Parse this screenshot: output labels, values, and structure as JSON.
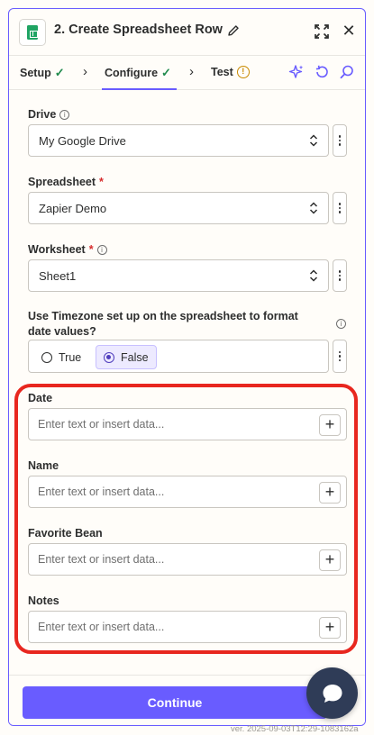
{
  "header": {
    "title": "2. Create Spreadsheet Row",
    "app_icon": "google-sheets-icon"
  },
  "tabs": [
    {
      "label": "Setup",
      "status": "complete"
    },
    {
      "label": "Configure",
      "status": "complete"
    },
    {
      "label": "Test",
      "status": "warning"
    }
  ],
  "fields": {
    "drive": {
      "label": "Drive",
      "value": "My Google Drive"
    },
    "spreadsheet": {
      "label": "Spreadsheet",
      "required": "*",
      "value": "Zapier Demo"
    },
    "worksheet": {
      "label": "Worksheet",
      "required": "*",
      "value": "Sheet1"
    },
    "timezone": {
      "label": "Use Timezone set up on the spreadsheet to format date values?",
      "options": [
        "True",
        "False"
      ],
      "selected": "False"
    },
    "columns": [
      {
        "label": "Date",
        "placeholder": "Enter text or insert data..."
      },
      {
        "label": "Name",
        "placeholder": "Enter text or insert data..."
      },
      {
        "label": "Favorite Bean",
        "placeholder": "Enter text or insert data..."
      },
      {
        "label": "Notes",
        "placeholder": "Enter text or insert data..."
      }
    ]
  },
  "footer": {
    "continue_label": "Continue"
  },
  "version": "ver. 2025-09-03T12:29-1083162a",
  "colors": {
    "accent": "#695cff",
    "highlight": "#e8271f",
    "check": "#1f8a4c"
  }
}
